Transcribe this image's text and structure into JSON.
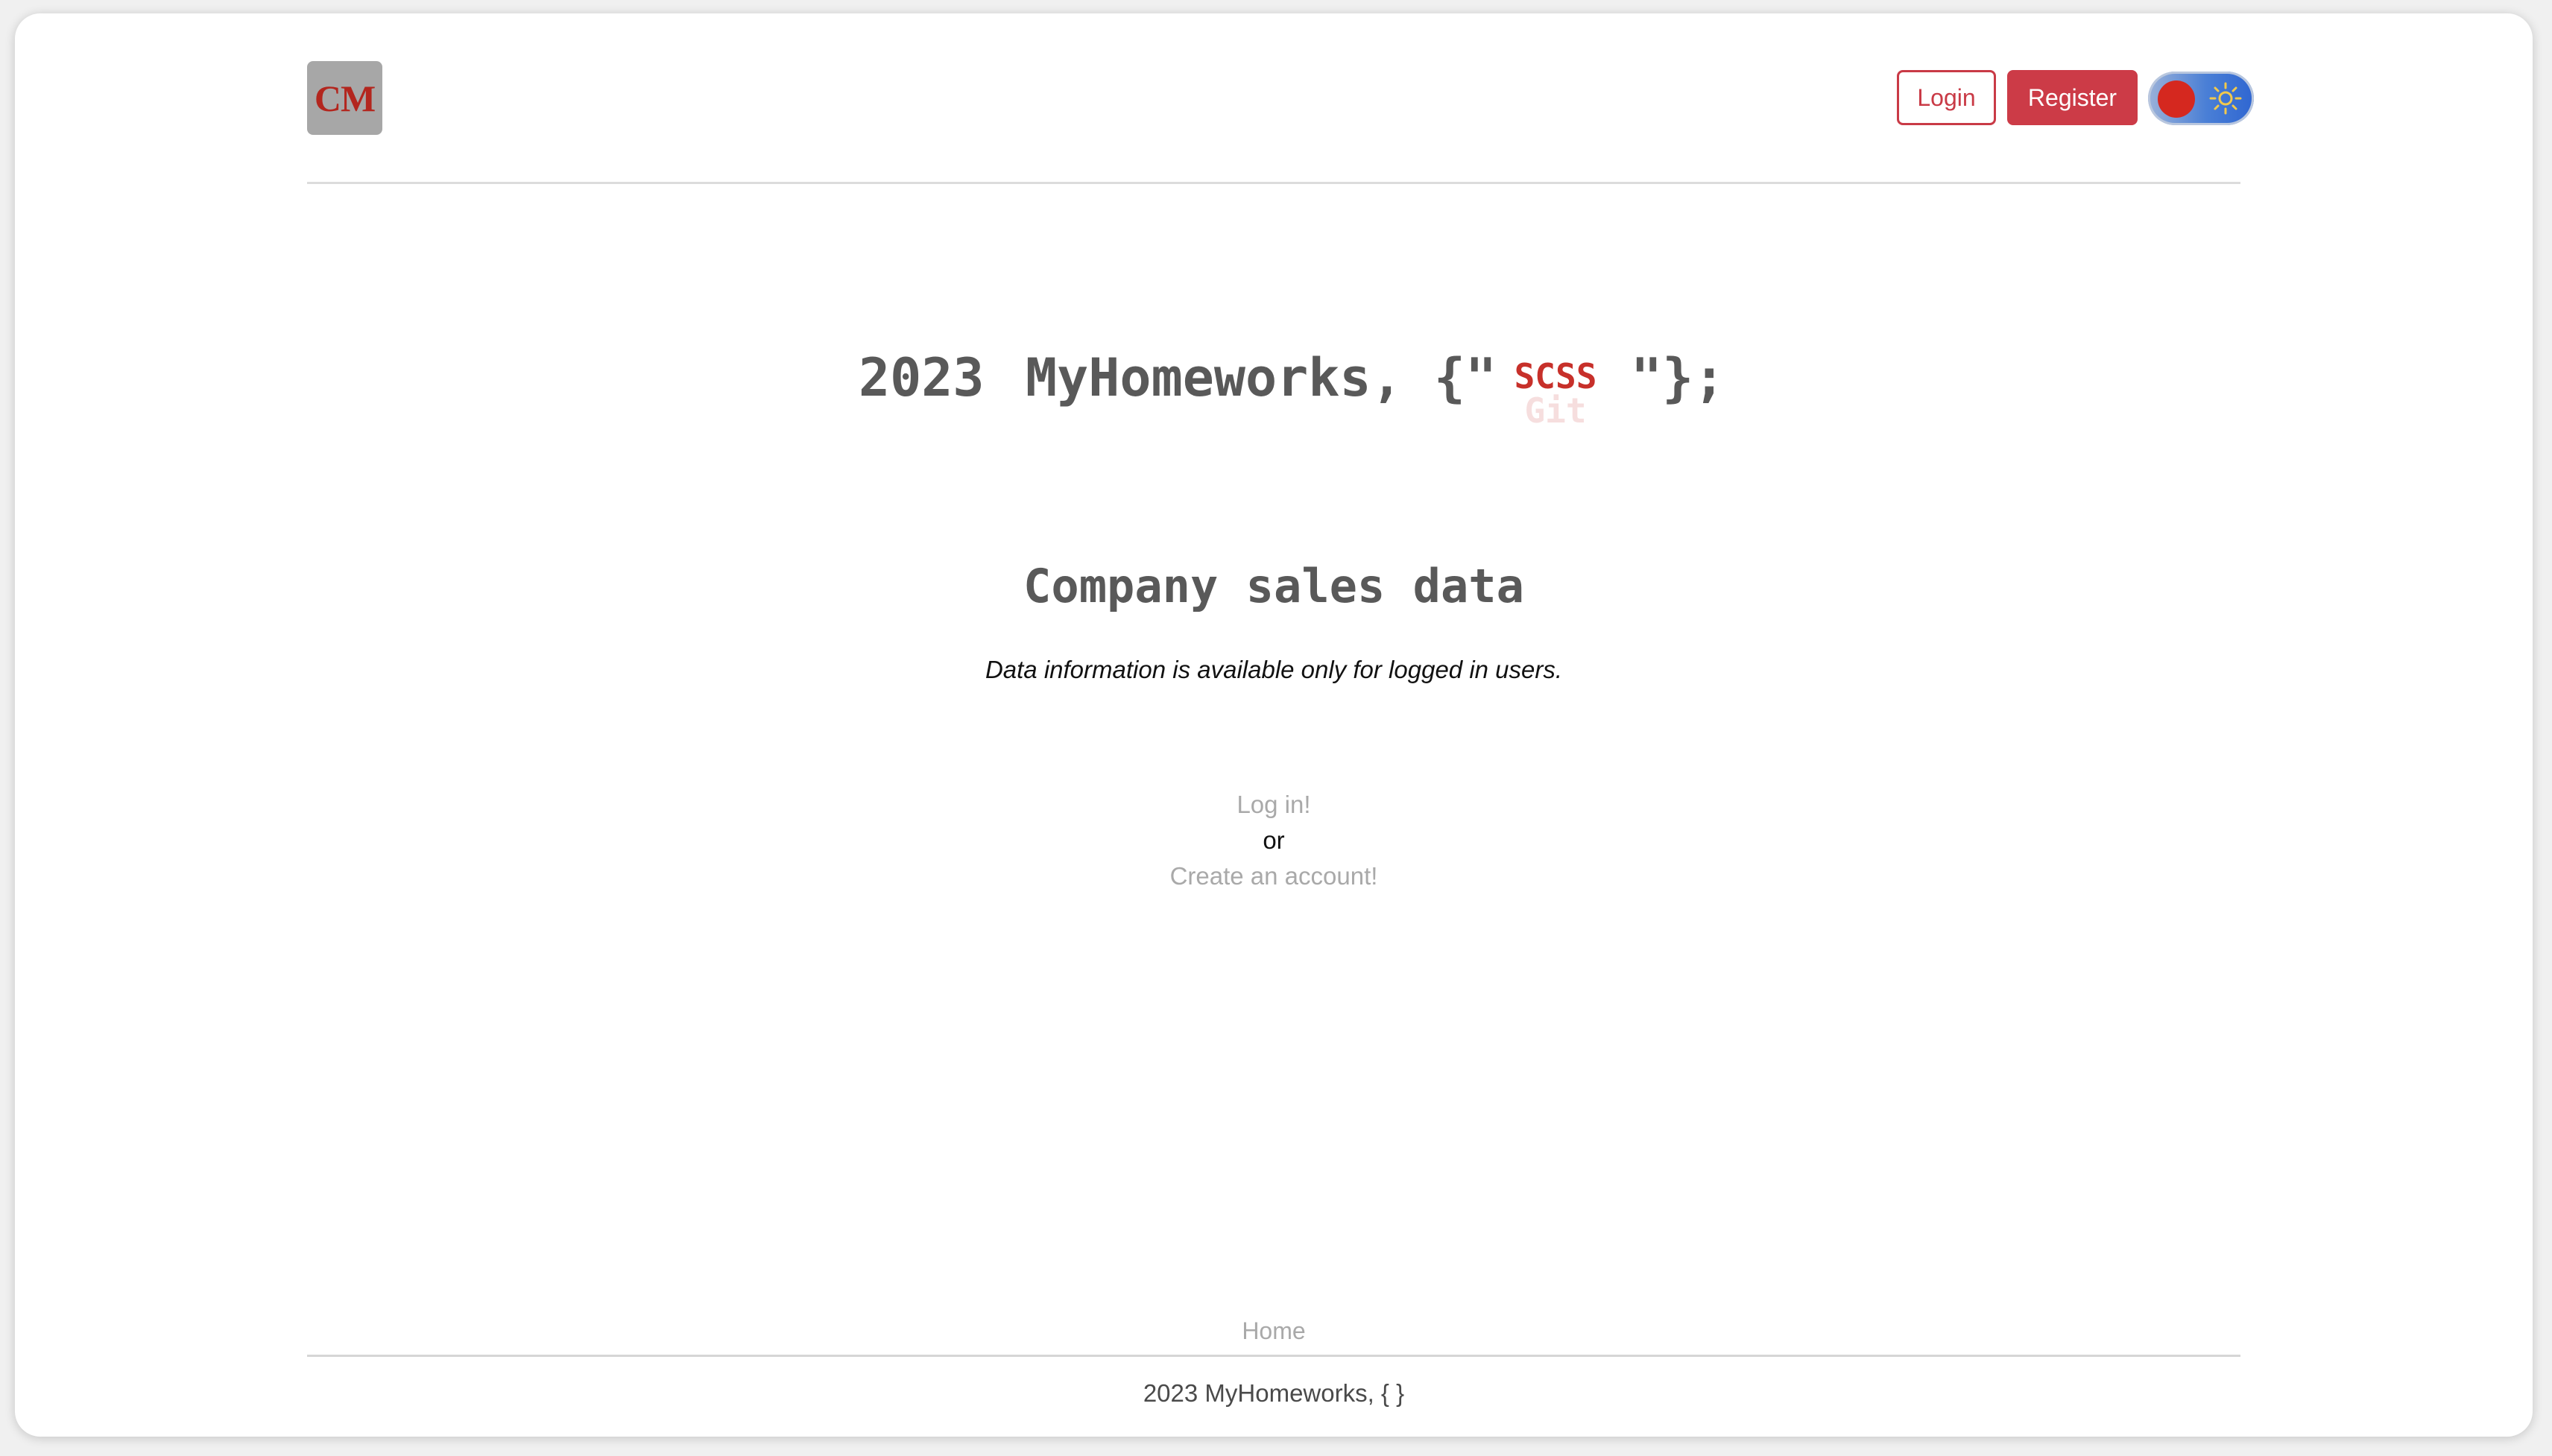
{
  "header": {
    "logo_text": "CM",
    "login_label": "Login",
    "register_label": "Register",
    "theme_toggle": {
      "icon": "sun-icon",
      "knob_color": "#d5281f"
    }
  },
  "hero": {
    "year": "2023",
    "brand": "MyHomeworks, {\"",
    "ticker_current": "SCSS",
    "ticker_next": "Git",
    "closing": "\"};"
  },
  "main": {
    "title": "Company sales data",
    "subtitle": "Data information is available only for logged in users.",
    "login_link": "Log in!",
    "or_text": "or",
    "create_link": "Create an account!"
  },
  "footer": {
    "nav_home": "Home",
    "copyright": "2023 MyHomeworks, { }"
  },
  "colors": {
    "accent": "#cc3b47",
    "text": "#595959",
    "muted": "#a9a9a9"
  }
}
